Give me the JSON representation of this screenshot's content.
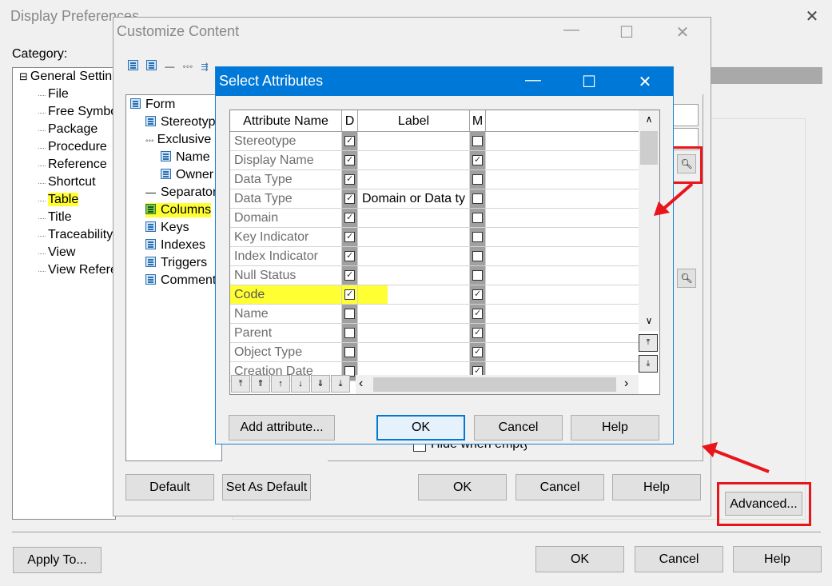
{
  "display_prefs": {
    "title": "Display Preferences",
    "category_label": "Category:",
    "tree": [
      {
        "label": "General Settings",
        "prefix": "⊟"
      },
      {
        "label": "File"
      },
      {
        "label": "Free Symbol"
      },
      {
        "label": "Package"
      },
      {
        "label": "Procedure"
      },
      {
        "label": "Reference"
      },
      {
        "label": "Shortcut"
      },
      {
        "label": "Table",
        "highlighted": true
      },
      {
        "label": "Title"
      },
      {
        "label": "Traceability"
      },
      {
        "label": "View"
      },
      {
        "label": "View Reference"
      }
    ],
    "advanced_label": "Advanced...",
    "hide_when_empty_label": "Hide when empty",
    "apply_to_label": "Apply To...",
    "ok_label": "OK",
    "cancel_label": "Cancel",
    "help_label": "Help"
  },
  "customize": {
    "title": "Customize Content",
    "tree": [
      {
        "label": "Form",
        "level": 0
      },
      {
        "label": "Stereotype",
        "level": 1
      },
      {
        "label": "Exclusive",
        "level": 1,
        "icon": "dots"
      },
      {
        "label": "Name",
        "level": 2
      },
      {
        "label": "Owner",
        "level": 2
      },
      {
        "label": "Separator",
        "level": 1,
        "icon": "line"
      },
      {
        "label": "Columns",
        "level": 1,
        "highlighted": true
      },
      {
        "label": "Keys",
        "level": 1
      },
      {
        "label": "Indexes",
        "level": 1
      },
      {
        "label": "Triggers",
        "level": 1
      },
      {
        "label": "Comment",
        "level": 1
      }
    ],
    "default_label": "Default",
    "set_as_default_label": "Set As Default",
    "ok_label": "OK",
    "cancel_label": "Cancel",
    "help_label": "Help"
  },
  "select_attributes": {
    "title": "Select Attributes",
    "columns": [
      "Attribute Name",
      "D",
      "Label",
      "M"
    ],
    "rows": [
      {
        "name": "Stereotype",
        "d": true,
        "label": "",
        "m": false
      },
      {
        "name": "Display Name",
        "d": true,
        "label": "",
        "m": true
      },
      {
        "name": "Data Type",
        "d": true,
        "label": "",
        "m": false
      },
      {
        "name": "Data Type",
        "d": true,
        "label": "Domain or Data ty",
        "m": false
      },
      {
        "name": "Domain",
        "d": true,
        "label": "",
        "m": false
      },
      {
        "name": "Key Indicator",
        "d": true,
        "label": "",
        "m": false
      },
      {
        "name": "Index Indicator",
        "d": true,
        "label": "",
        "m": false
      },
      {
        "name": "Null Status",
        "d": true,
        "label": "",
        "m": false
      },
      {
        "name": "Code",
        "d": true,
        "label": "",
        "m": true,
        "highlighted": true
      },
      {
        "name": "Name",
        "d": false,
        "label": "",
        "m": true
      },
      {
        "name": "Parent",
        "d": false,
        "label": "",
        "m": true
      },
      {
        "name": "Object Type",
        "d": false,
        "label": "",
        "m": true
      },
      {
        "name": "Creation Date",
        "d": false,
        "label": "",
        "m": true
      }
    ],
    "add_attribute_label": "Add attribute...",
    "ok_label": "OK",
    "cancel_label": "Cancel",
    "help_label": "Help"
  },
  "colors": {
    "titlebar_active": "#0078d7",
    "highlight": "#ffff33",
    "annotation_red": "#e8151b"
  }
}
